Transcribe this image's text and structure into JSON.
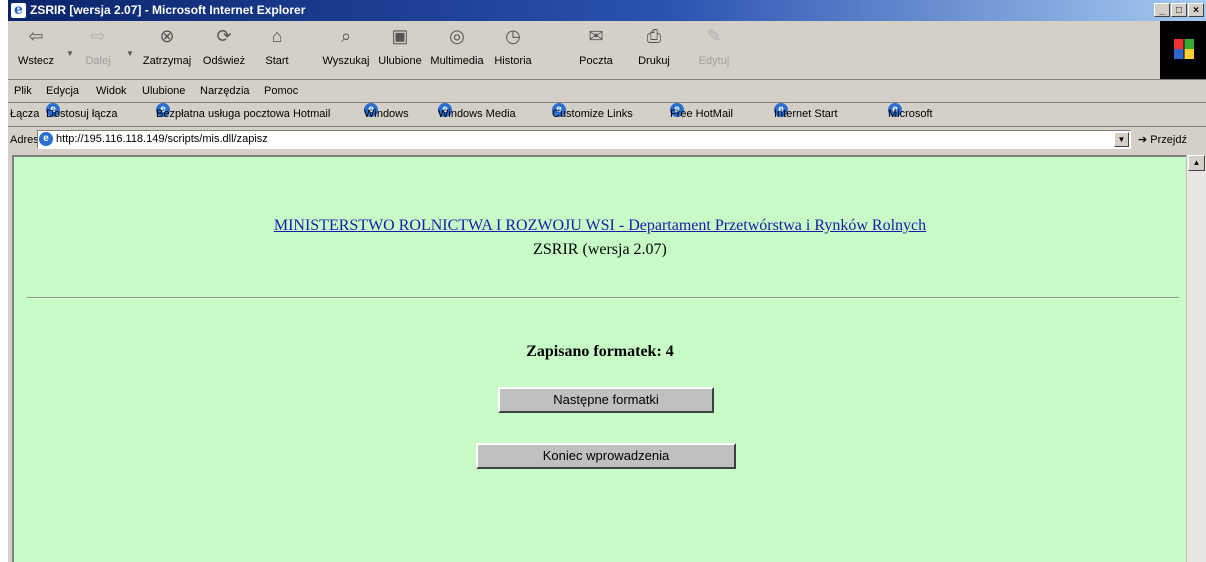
{
  "window": {
    "title": "ZSRIR [wersja 2.07] - Microsoft Internet Explorer",
    "controls": [
      "_",
      "□",
      "×"
    ]
  },
  "toolbar": {
    "buttons": [
      {
        "label": "Wstecz",
        "icon": "back-arrow-icon",
        "glyph": "⇦"
      },
      {
        "label": "Dalej",
        "icon": "forward-arrow-icon",
        "glyph": "⇨"
      },
      {
        "label": "Zatrzymaj",
        "icon": "stop-icon",
        "glyph": "⊗"
      },
      {
        "label": "Odśwież",
        "icon": "refresh-icon",
        "glyph": "⟳"
      },
      {
        "label": "Start",
        "icon": "home-icon",
        "glyph": "⌂"
      },
      {
        "label": "Wyszukaj",
        "icon": "search-icon",
        "glyph": "⌕"
      },
      {
        "label": "Ulubione",
        "icon": "favorites-icon",
        "glyph": "▣"
      },
      {
        "label": "Multimedia",
        "icon": "media-icon",
        "glyph": "◎"
      },
      {
        "label": "Historia",
        "icon": "history-icon",
        "glyph": "◷"
      },
      {
        "label": "Poczta",
        "icon": "mail-icon",
        "glyph": "✉"
      },
      {
        "label": "Drukuj",
        "icon": "print-icon",
        "glyph": "⎙"
      },
      {
        "label": "Edytuj",
        "icon": "edit-icon",
        "glyph": "✎"
      }
    ]
  },
  "menu": [
    "Plik",
    "Edycja",
    "Widok",
    "Ulubione",
    "Narzędzia",
    "Pomoc"
  ],
  "links": {
    "label": "Łącza",
    "items": [
      "Dostosuj łącza",
      "Bezpłatna usługa pocztowa Hotmail",
      "Windows",
      "Windows Media",
      "Customize Links",
      "Free HotMail",
      "Internet Start",
      "Microsoft"
    ]
  },
  "address": {
    "label": "Adres",
    "url": "http://195.116.118.149/scripts/mis.dll/zapisz",
    "go_label": "Przejdź"
  },
  "page": {
    "ministry_link": "MINISTERSTWO ROLNICTWA I ROZWOJU WSI - Departament Przetwórstwa i Rynków Rolnych",
    "version": "ZSRIR (wersja 2.07)",
    "saved_text": "Zapisano formatek: 4",
    "next_button": "Następne formatki",
    "end_button": "Koniec wprowadzenia"
  }
}
